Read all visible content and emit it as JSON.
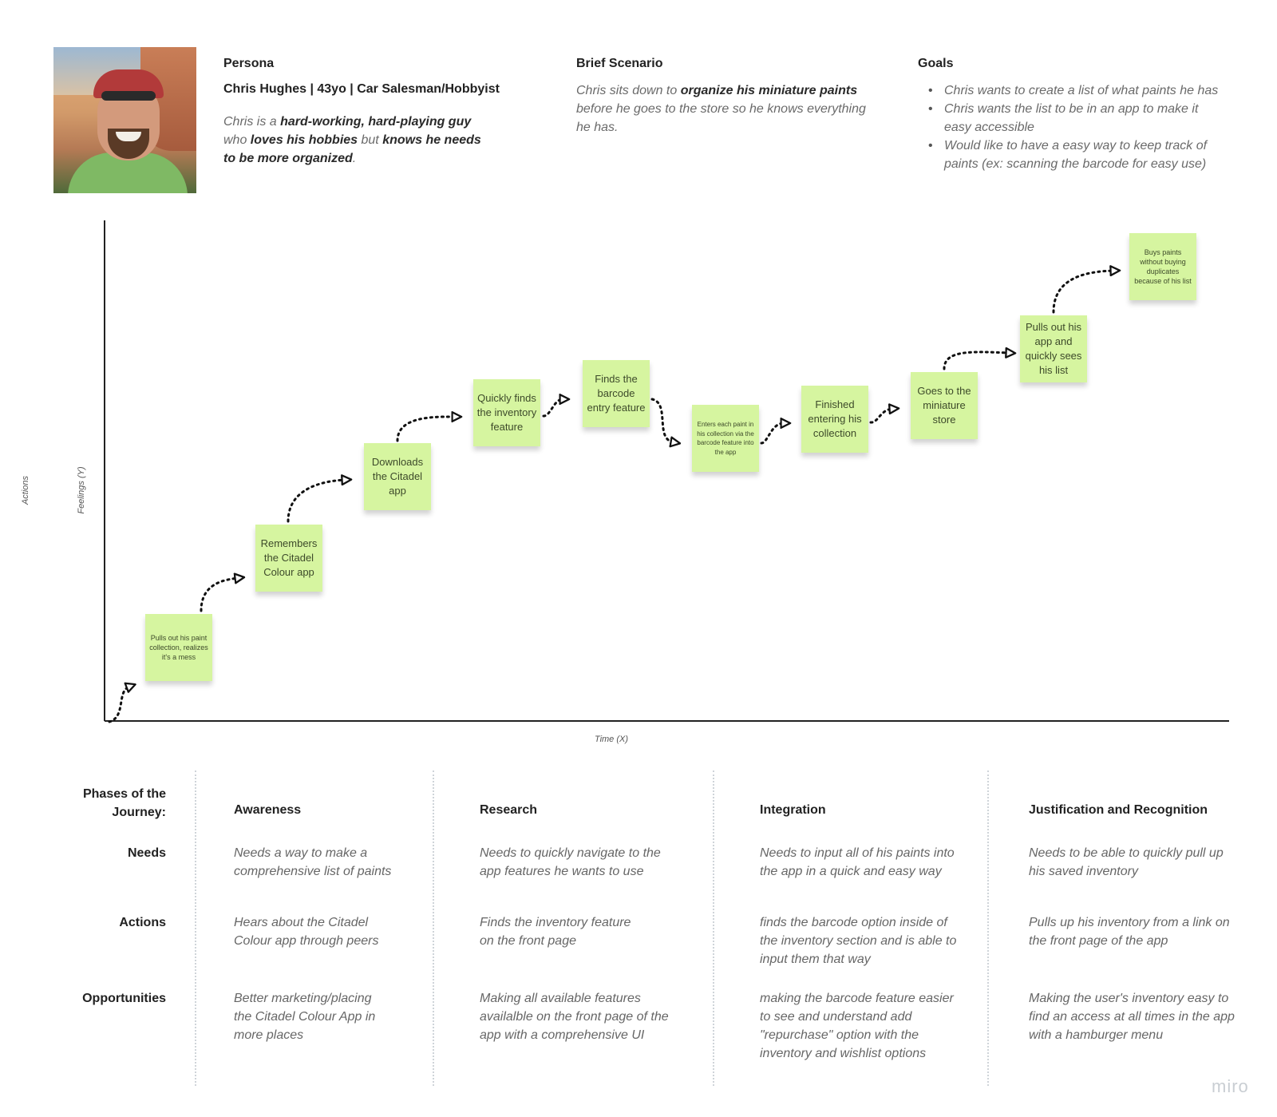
{
  "persona": {
    "section_title": "Persona",
    "name_line": "Chris Hughes | 43yo | Car Salesman/Hobbyist",
    "desc": {
      "t1": "Chris is a ",
      "b1": "hard-working, hard-playing guy",
      "t2": " who ",
      "b2": "loves his hobbies",
      "t3": " but ",
      "b3": "knows he needs to be more organized",
      "t4": "."
    }
  },
  "scenario": {
    "title": "Brief Scenario",
    "t1": "Chris sits down to ",
    "b1": "organize his miniature paints",
    "t2": " before he goes to the store so he knows everything he has."
  },
  "goals": {
    "title": "Goals",
    "items": [
      "Chris wants to create a list of what paints he has",
      "Chris wants the list to be in an app to make it easy accessible",
      "Would like to have a easy way to keep track of paints (ex: scanning the barcode for easy use)"
    ]
  },
  "chart_labels": {
    "actions": "Actions",
    "feelings": "Feelings (Y)",
    "time": "Time (X)"
  },
  "notes": [
    "Pulls out his paint collection, realizes it's a mess",
    "Remembers the Citadel Colour app",
    "Downloads the Citadel app",
    "Quickly finds the inventory feature",
    "Finds the barcode entry feature",
    "Enters each paint in his collection via the barcode feature into the app",
    "Finished entering his collection",
    "Goes to the miniature store",
    "Pulls out his app and quickly sees his list",
    "Buys paints without buying duplicates because of his list"
  ],
  "table": {
    "phases_label": "Phases of the Journey:",
    "row_labels": {
      "needs": "Needs",
      "actions": "Actions",
      "opportunities": "Opportunities"
    },
    "phases": [
      {
        "name": "Awareness",
        "needs": "Needs a way to make a comprehensive list of paints",
        "actions": "Hears about the Citadel Colour app through peers",
        "opportunities": "Better marketing/placing the Citadel Colour App in more places"
      },
      {
        "name": "Research",
        "needs": "Needs to quickly navigate to the app features he wants to use",
        "actions": "Finds the inventory feature on the front page",
        "opportunities": "Making all available features availalble on the front page of the app with a comprehensive UI"
      },
      {
        "name": "Integration",
        "needs": "Needs to input all of his paints into the app in a quick and easy way",
        "actions": "finds the barcode option inside of the inventory section and is able to input them that way",
        "opportunities": "making the barcode feature easier to see and understand add \"repurchase\" option with the inventory and wishlist options"
      },
      {
        "name": "Justification and Recognition",
        "needs": "Needs to be able to quickly pull up his saved inventory",
        "actions": "Pulls up his inventory from a link on the front page of the app",
        "opportunities": "Making the user's inventory easy to find an access at all times in the app with a hamburger menu"
      }
    ]
  },
  "watermark": "miro",
  "colors": {
    "note": "#d6f5a0",
    "axis": "#222222"
  }
}
